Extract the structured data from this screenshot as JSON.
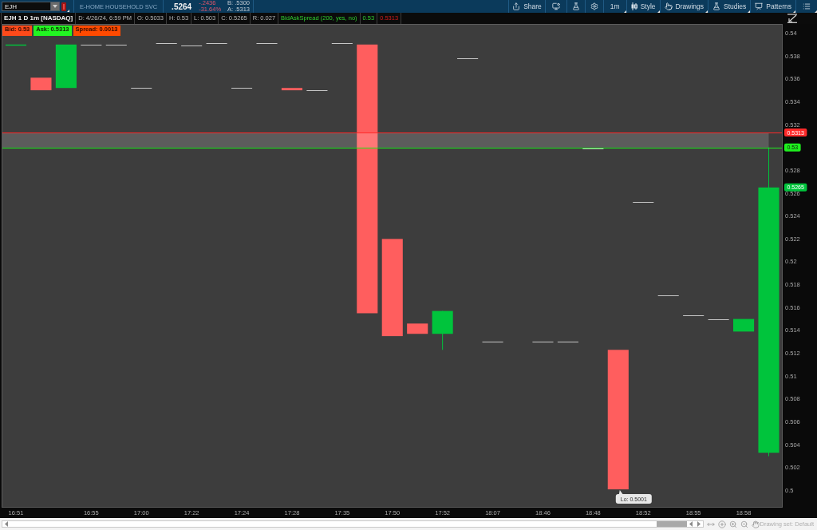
{
  "header": {
    "symbol": "EJH",
    "company": "E-HOME HOUSEHOLD SVC",
    "last": ".5264",
    "change": "-.2436",
    "change_percent": "-31.64%",
    "bid": "B: .5300",
    "ask": "A: .5313",
    "toolbar": {
      "share": "Share",
      "interval": "1m",
      "style": "Style",
      "drawings": "Drawings",
      "studies": "Studies",
      "patterns": "Patterns"
    }
  },
  "info_bar": {
    "title": "EJH 1 D 1m [NASDAQ]",
    "cells": [
      "D: 4/26/24, 6:59 PM",
      "O: 0.5033",
      "H: 0.53",
      "L: 0.503",
      "C: 0.5265",
      "R: 0.027"
    ],
    "study": [
      {
        "text": "BidAskSpread (200, yes, no)",
        "kind": "name"
      },
      {
        "text": "0.53",
        "kind": "bid"
      },
      {
        "text": "0.5313",
        "kind": "ask"
      }
    ]
  },
  "chart": {
    "badges": [
      {
        "text": "Bid: 0.53",
        "color": "#ff4a1a"
      },
      {
        "text": "Ask: 0.5313",
        "color": "#22f522"
      },
      {
        "text": "Spread: 0.0013",
        "color": "#ff4a00"
      }
    ],
    "chart_data": {
      "type": "bar",
      "categories": [
        "16:51",
        null,
        null,
        "16:55",
        null,
        "17:00",
        null,
        "17:22",
        null,
        "17:24",
        null,
        "17:28",
        null,
        "17:35",
        null,
        "17:50",
        null,
        "17:52",
        null,
        "18:07",
        null,
        "18:46",
        null,
        "18:48",
        null,
        "18:52",
        null,
        "18:55",
        null,
        "18:58",
        null
      ],
      "ylim": [
        0.4985,
        0.5408
      ],
      "yticks": [
        0.54,
        0.538,
        0.536,
        0.534,
        0.532,
        0.528,
        0.526,
        0.524,
        0.522,
        0.52,
        0.518,
        0.516,
        0.514,
        0.512,
        0.51,
        0.508,
        0.506,
        0.504,
        0.502,
        0.5
      ],
      "bands": [
        {
          "axis": "y",
          "from": 0.53,
          "to": 0.5313
        }
      ],
      "ref_lines": [
        {
          "axis": "y",
          "value": 0.5313,
          "label": "0.5313",
          "color": "#ff2a2a"
        },
        {
          "axis": "y",
          "value": 0.53,
          "label": "0.53",
          "color": "#1ef01e"
        }
      ]
    },
    "last_price_tag": "0.5265",
    "low_callout": "Lo: 0.5001"
  },
  "footer": {
    "drawing_set": "Drawing set: Default"
  }
}
